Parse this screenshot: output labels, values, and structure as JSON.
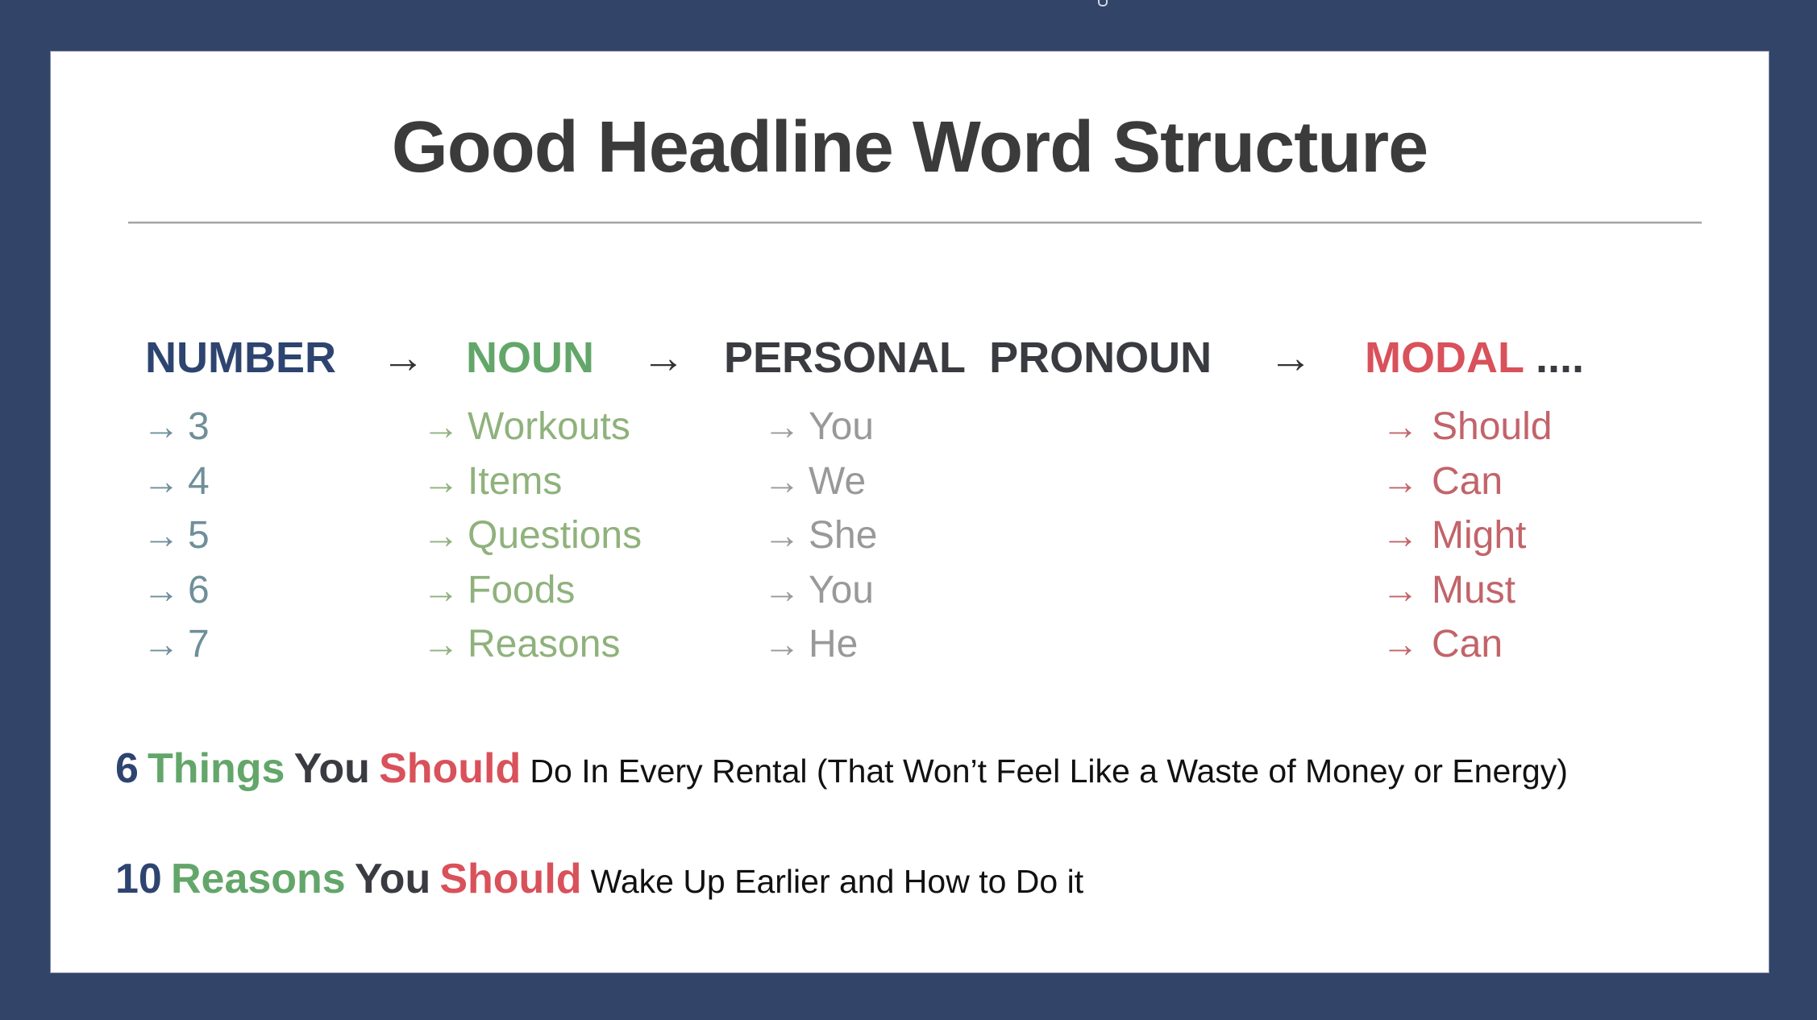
{
  "slide": {
    "title": "Good Headline Word Structure",
    "structure": {
      "columns": [
        {
          "id": "number",
          "header": "NUMBER",
          "color": "#2e4470",
          "items": [
            "3",
            "4",
            "5",
            "6",
            "7"
          ]
        },
        {
          "id": "noun",
          "header": "NOUN",
          "color": "#63a66a",
          "items": [
            "Workouts",
            "Items",
            "Questions",
            "Foods",
            "Reasons"
          ]
        },
        {
          "id": "personal-pronoun",
          "header": "PERSONAL  PRONOUN",
          "color": "#3a3b40",
          "items": [
            "You",
            "We",
            "She",
            "You",
            "He"
          ]
        },
        {
          "id": "modal",
          "header": "MODAL",
          "header_suffix": "....",
          "color": "#d9515a",
          "items": [
            "Should",
            "Can",
            "Might",
            "Must",
            "Can"
          ]
        }
      ],
      "arrow_glyph": "→"
    },
    "examples": [
      {
        "number": "6",
        "noun": "Things",
        "pronoun": "You",
        "modal": "Should",
        "rest": "Do In Every Rental (That Won’t Feel Like a Waste of Money or Energy)"
      },
      {
        "number": "10",
        "noun": "Reasons",
        "pronoun": "You",
        "modal": "Should",
        "rest": "Wake Up Earlier and How to Do it"
      }
    ]
  },
  "colors": {
    "background": "#324468",
    "slide": "#ffffff",
    "title": "#3b3b3b"
  }
}
